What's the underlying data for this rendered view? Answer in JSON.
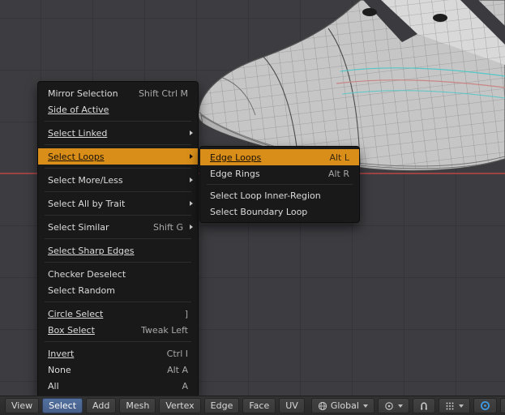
{
  "viewport": {
    "description": "3D viewport with shoe mesh in edit mode",
    "axis_color": "#9c4444"
  },
  "select_menu": {
    "items": [
      {
        "label": "Mirror Selection",
        "shortcut": "Shift Ctrl M"
      },
      {
        "label": "Side of Active",
        "shortcut": ""
      },
      {
        "label": "Select Linked",
        "shortcut": "",
        "submenu": true
      },
      {
        "label": "Select Loops",
        "shortcut": "",
        "submenu": true,
        "highlighted": true
      },
      {
        "label": "Select More/Less",
        "shortcut": "",
        "submenu": true
      },
      {
        "label": "Select All by Trait",
        "shortcut": "",
        "submenu": true
      },
      {
        "label": "Select Similar",
        "shortcut": "Shift G",
        "submenu": true
      },
      {
        "label": "Select Sharp Edges",
        "shortcut": ""
      },
      {
        "label": "Checker Deselect",
        "shortcut": ""
      },
      {
        "label": "Select Random",
        "shortcut": ""
      },
      {
        "label": "Circle Select",
        "shortcut": "]"
      },
      {
        "label": "Box Select",
        "shortcut": "Tweak Left"
      },
      {
        "label": "Invert",
        "shortcut": "Ctrl I"
      },
      {
        "label": "None",
        "shortcut": "Alt A"
      },
      {
        "label": "All",
        "shortcut": "A"
      }
    ]
  },
  "loops_submenu": {
    "items": [
      {
        "label": "Edge Loops",
        "shortcut": "Alt L",
        "highlighted": true
      },
      {
        "label": "Edge Rings",
        "shortcut": "Alt R"
      },
      {
        "label": "Select Loop Inner-Region",
        "shortcut": ""
      },
      {
        "label": "Select Boundary Loop",
        "shortcut": ""
      }
    ]
  },
  "header": {
    "menus": [
      {
        "label": "View"
      },
      {
        "label": "Select",
        "active": true
      },
      {
        "label": "Add"
      },
      {
        "label": "Mesh"
      },
      {
        "label": "Vertex"
      },
      {
        "label": "Edge"
      },
      {
        "label": "Face"
      },
      {
        "label": "UV"
      }
    ],
    "orientation": {
      "label": "Global",
      "icon": "globe-icon"
    },
    "pivot": {
      "icon": "pivot-point-icon"
    },
    "snap": {
      "icon": "magnet-icon"
    },
    "snap_element": {
      "icon": "snap-grid-icon"
    },
    "proportional": {
      "icon": "proportional-editing-icon",
      "color": "#3d9ae5"
    },
    "falloff": {
      "icon": "falloff-curve-icon"
    }
  },
  "colors": {
    "menu_highlight": "#d98e1a",
    "active_menu_button": "#47608a",
    "axis_red": "#9c4444",
    "proportional_blue": "#3d9ae5"
  }
}
